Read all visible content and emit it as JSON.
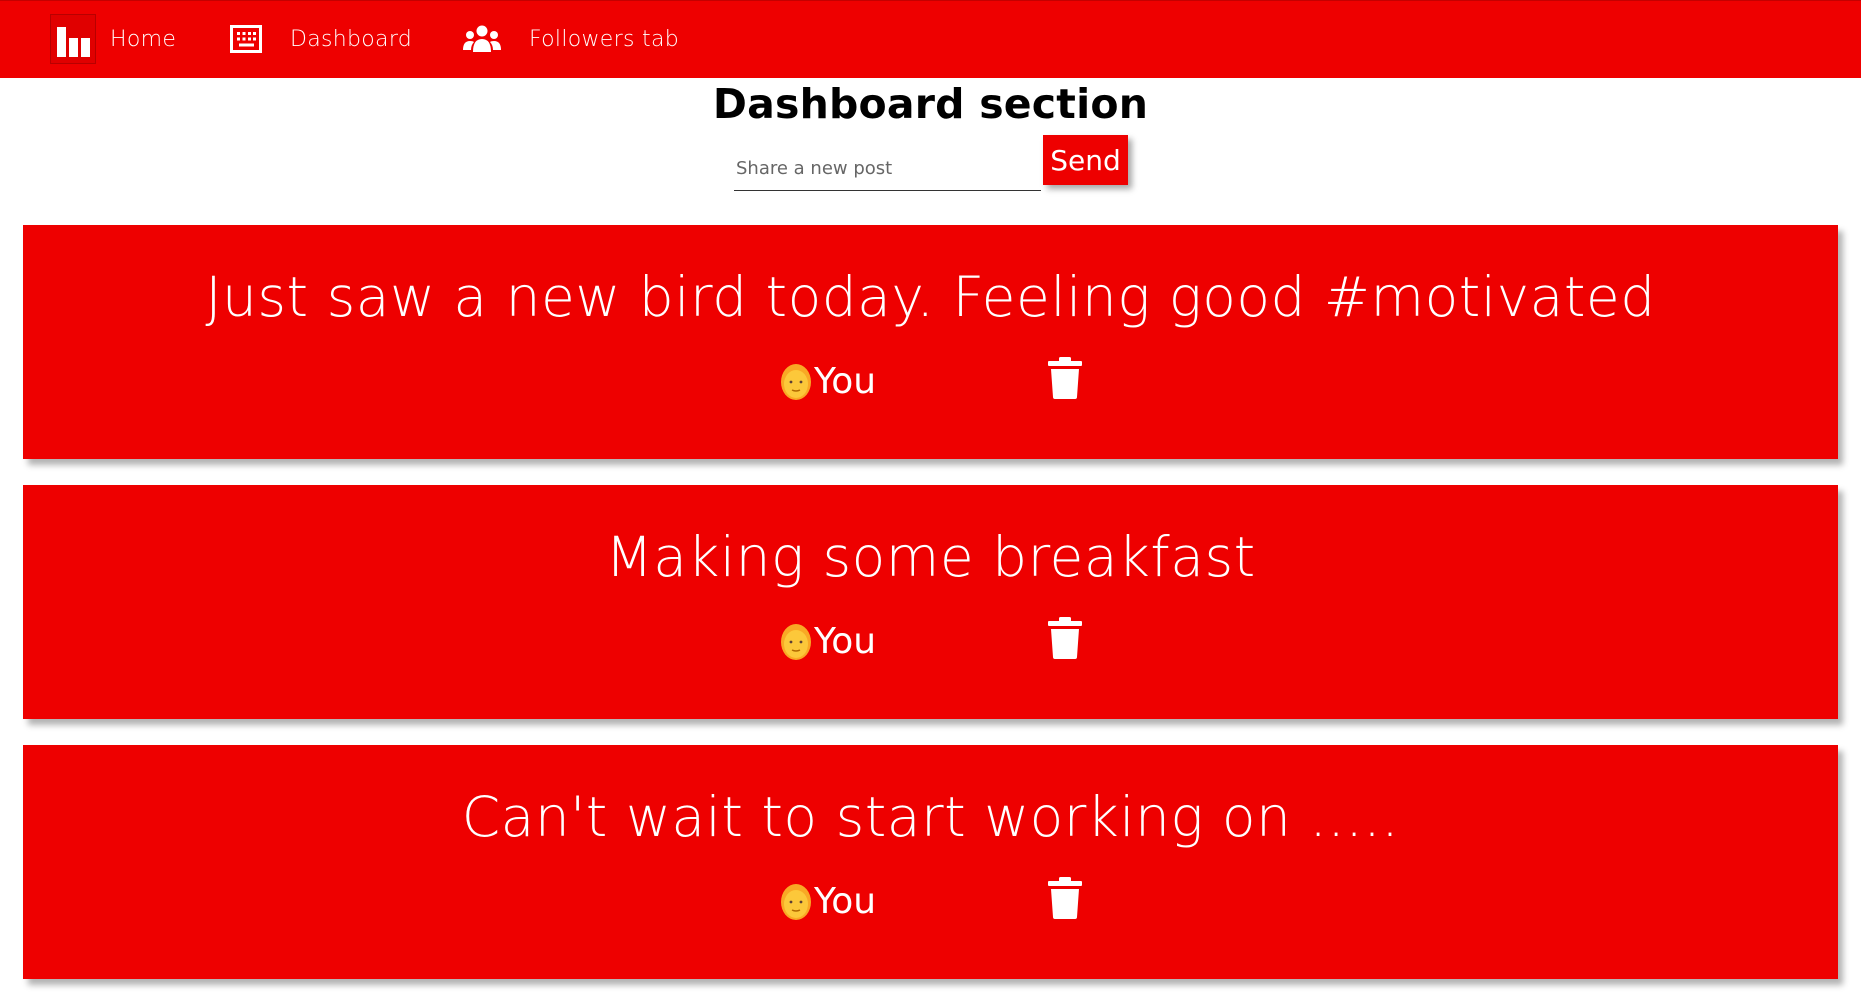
{
  "navbar": {
    "items": [
      {
        "label": "Home",
        "icon": "bar-chart-logo-icon"
      },
      {
        "label": "Dashboard",
        "icon": "keyboard-icon"
      },
      {
        "label": "Followers tab",
        "icon": "users-icon"
      }
    ]
  },
  "dashboard": {
    "title": "Dashboard section",
    "post_placeholder": "Share a new post",
    "send_label": "Send"
  },
  "posts": [
    {
      "text": "Just saw a new bird today. Feeling good #motivated",
      "author": "You",
      "avatar": "person-emoji",
      "delete_icon": "trash-icon"
    },
    {
      "text": "Making some breakfast",
      "author": "You",
      "avatar": "person-emoji",
      "delete_icon": "trash-icon"
    },
    {
      "text": "Can't wait to start working on .....",
      "author": "You",
      "avatar": "person-emoji",
      "delete_icon": "trash-icon"
    }
  ],
  "colors": {
    "brand_red": "#ee0000",
    "text_on_brand": "#ffffff",
    "title": "#000000"
  }
}
